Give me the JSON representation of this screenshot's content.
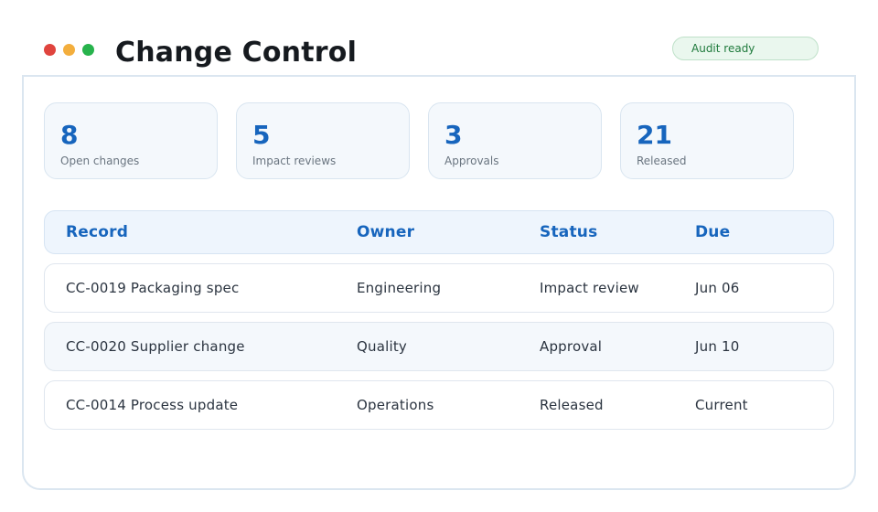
{
  "title": "Change Control",
  "badge": "Audit ready",
  "window_controls": [
    "close",
    "minimize",
    "maximize"
  ],
  "colors": {
    "accent": "#1765bd",
    "badge_text": "#1f7a3c",
    "badge_bg": "#eaf7ee",
    "dot_red": "#e0443e",
    "dot_yellow": "#f3ae3d",
    "dot_green": "#27b34c"
  },
  "stats": [
    {
      "value": "8",
      "label": "Open changes"
    },
    {
      "value": "5",
      "label": "Impact reviews"
    },
    {
      "value": "3",
      "label": "Approvals"
    },
    {
      "value": "21",
      "label": "Released"
    }
  ],
  "table": {
    "columns": [
      "Record",
      "Owner",
      "Status",
      "Due"
    ],
    "rows": [
      [
        "CC-0019 Packaging spec",
        "Engineering",
        "Impact review",
        "Jun 06"
      ],
      [
        "CC-0020 Supplier change",
        "Quality",
        "Approval",
        "Jun 10"
      ],
      [
        "CC-0014 Process update",
        "Operations",
        "Released",
        "Current"
      ]
    ]
  }
}
